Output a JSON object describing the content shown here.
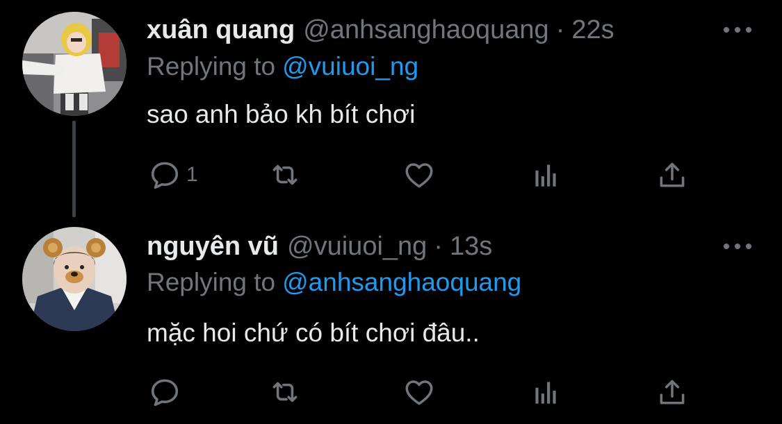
{
  "colors": {
    "background": "#000000",
    "primary_text": "#e7e9ea",
    "secondary_text": "#71767b",
    "accent": "#1d9bf0",
    "thread_line": "#3e4144"
  },
  "tweets": [
    {
      "display_name": "xuân quang",
      "handle": "@anhsanghaoquang",
      "separator": "·",
      "time": "22s",
      "replying_label": "Replying to",
      "replying_to": "@vuiuoi_ng",
      "text": "sao anh bảo kh bít chơi",
      "reply_count": "1",
      "icons": [
        "comment-icon",
        "retweet-icon",
        "heart-icon",
        "analytics-icon",
        "share-icon",
        "more-icon"
      ]
    },
    {
      "display_name": "nguyên vũ",
      "handle": "@vuiuoi_ng",
      "separator": "·",
      "time": "13s",
      "replying_label": "Replying to",
      "replying_to": "@anhsanghaoquang",
      "text": "mặc hoi chứ có bít chơi đâu..",
      "reply_count": "",
      "icons": [
        "comment-icon",
        "retweet-icon",
        "heart-icon",
        "analytics-icon",
        "share-icon",
        "more-icon"
      ]
    }
  ]
}
